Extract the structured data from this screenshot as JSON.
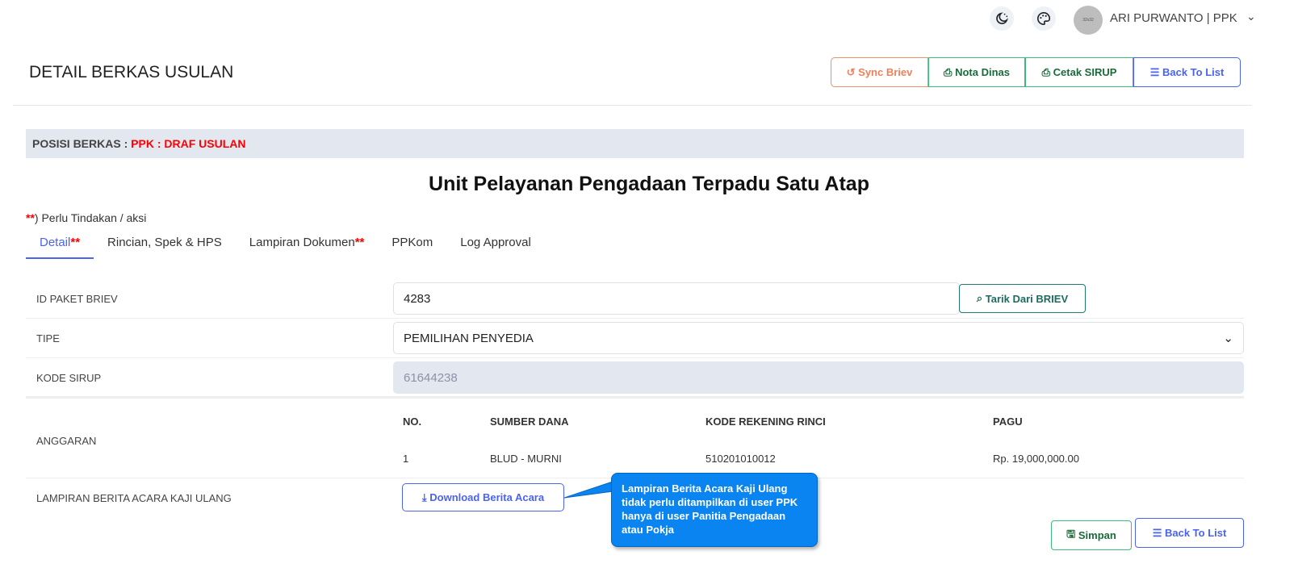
{
  "header": {
    "user": "ARI PURWANTO | PPK",
    "avatar_text": "32x32",
    "icons": [
      "moon-stars-icon",
      "palette-icon",
      "chevron-down-icon"
    ]
  },
  "page": {
    "title": "DETAIL BERKAS USULAN",
    "actions": {
      "sync": "Sync Briev",
      "nota": "Nota Dinas",
      "cetak": "Cetak SIRUP",
      "back": "Back To List"
    }
  },
  "posisi": {
    "label": "POSISI BERKAS : ",
    "value": "PPK : DRAF USULAN"
  },
  "unit_title": "Unit Pelayanan Pengadaan Terpadu Satu Atap",
  "note": {
    "mark": "**",
    "text": ") Perlu Tindakan / aksi"
  },
  "tabs": [
    {
      "label": "Detail",
      "mark": "**"
    },
    {
      "label": "Rincian, Spek & HPS",
      "mark": ""
    },
    {
      "label": "Lampiran Dokumen",
      "mark": "**"
    },
    {
      "label": "PPKom",
      "mark": ""
    },
    {
      "label": "Log Approval",
      "mark": ""
    }
  ],
  "form": {
    "id_paket": {
      "label": "ID PAKET BRIEV",
      "value": "4283",
      "button": "Tarik Dari BRIEV"
    },
    "tipe": {
      "label": "TIPE",
      "value": "PEMILIHAN PENYEDIA"
    },
    "kode_sirup": {
      "label": "KODE SIRUP",
      "value": "61644238"
    },
    "anggaran": {
      "label": "ANGGARAN",
      "headers": [
        "NO.",
        "SUMBER DANA",
        "KODE REKENING RINCI",
        "PAGU"
      ],
      "rows": [
        [
          "1",
          "BLUD - MURNI",
          "510201010012",
          "Rp. 19,000,000.00"
        ]
      ]
    },
    "lampiran": {
      "label": "LAMPIRAN BERITA ACARA KAJI ULANG",
      "button": "Download Berita Acara"
    }
  },
  "tooltip": "Lampiran Berita Acara Kaji Ulang tidak perlu ditampilkan di user PPK hanya di user Panitia Pengadaan atau Pokja",
  "footer": {
    "simpan": "Simpan",
    "back": "Back To List"
  },
  "colors": {
    "primary": "#4a63f0",
    "success": "#3dba7e",
    "warning": "#f0805a",
    "danger": "#ff0000",
    "tooltip": "#0a84f0"
  }
}
